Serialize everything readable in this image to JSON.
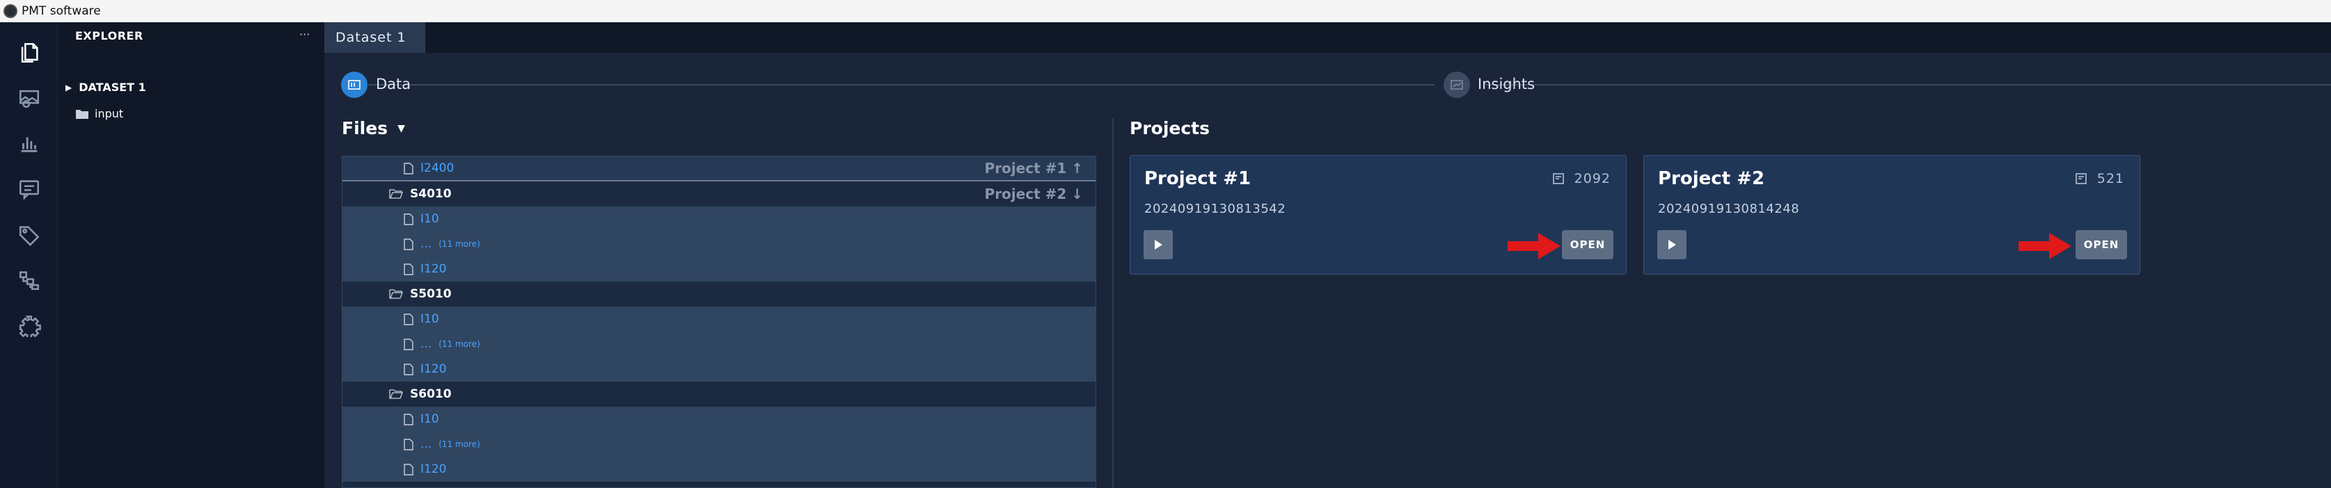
{
  "window": {
    "title": "PMT software"
  },
  "activity_bar": {
    "icons": [
      "files-icon",
      "image-gallery-icon",
      "bar-chart-icon",
      "messages-icon",
      "tag-icon",
      "workflow-icon",
      "settings-icon"
    ]
  },
  "explorer": {
    "header": "EXPLORER",
    "more_label": "···",
    "dataset_label": "DATASET 1",
    "input_folder": "input"
  },
  "tabs": [
    {
      "label": "Dataset 1",
      "active": true
    }
  ],
  "stepper": {
    "steps": [
      {
        "label": "Data",
        "active": true
      },
      {
        "label": "Insights",
        "active": false
      }
    ]
  },
  "files": {
    "title": "Files",
    "rows": [
      {
        "kind": "file",
        "name": "I2400",
        "project_tag": "Project #1",
        "tag_arrow": "↑"
      },
      {
        "kind": "folder",
        "name": "S4010",
        "project_tag": "Project #2",
        "tag_arrow": "↓"
      },
      {
        "kind": "file",
        "name": "I10"
      },
      {
        "kind": "more",
        "name": "...",
        "more": "(11 more)"
      },
      {
        "kind": "file",
        "name": "I120"
      },
      {
        "kind": "folder",
        "name": "S5010"
      },
      {
        "kind": "file",
        "name": "I10"
      },
      {
        "kind": "more",
        "name": "...",
        "more": "(11 more)"
      },
      {
        "kind": "file",
        "name": "I120"
      },
      {
        "kind": "folder",
        "name": "S6010"
      },
      {
        "kind": "file",
        "name": "I10"
      },
      {
        "kind": "more",
        "name": "...",
        "more": "(11 more)"
      },
      {
        "kind": "file",
        "name": "I120"
      }
    ]
  },
  "projects": {
    "title": "Projects",
    "cards": [
      {
        "title": "Project #1",
        "count": "2092",
        "date": "20240919130813542",
        "open_label": "OPEN"
      },
      {
        "title": "Project #2",
        "count": "521",
        "date": "20240919130814248",
        "open_label": "OPEN"
      }
    ]
  },
  "colors": {
    "accent": "#2a83d6",
    "annotation_arrow": "#e0191b",
    "link": "#4aa3ff"
  }
}
